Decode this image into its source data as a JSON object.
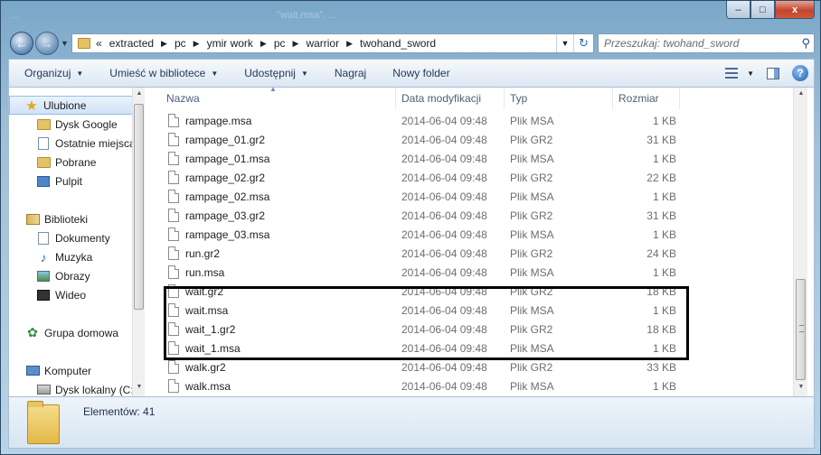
{
  "window": {
    "title_ghost": "...",
    "title_ghost2": "\"wait.msa\", ...",
    "controls": {
      "minimize": "–",
      "maximize": "□",
      "close": "x"
    }
  },
  "address": {
    "overflow": "«",
    "segments": [
      "extracted",
      "pc",
      "ymir work",
      "pc",
      "warrior",
      "twohand_sword"
    ]
  },
  "search": {
    "placeholder": "Przeszukaj: twohand_sword"
  },
  "toolbar": {
    "organize": "Organizuj",
    "library": "Umieść w bibliotece",
    "share": "Udostępnij",
    "burn": "Nagraj",
    "new_folder": "Nowy folder",
    "help": "?"
  },
  "navpane": {
    "favorites": "Ulubione",
    "google_drive": "Dysk Google",
    "recent": "Ostatnie miejsca",
    "downloads": "Pobrane",
    "desktop": "Pulpit",
    "libraries": "Biblioteki",
    "documents": "Dokumenty",
    "music": "Muzyka",
    "pictures": "Obrazy",
    "videos": "Wideo",
    "homegroup": "Grupa domowa",
    "computer": "Komputer",
    "local_disk": "Dysk lokalny (C:)"
  },
  "columns": {
    "name": "Nazwa",
    "date": "Data modyfikacji",
    "type": "Typ",
    "size": "Rozmiar"
  },
  "files": [
    {
      "name": "rampage.msa",
      "date": "2014-06-04 09:48",
      "type": "Plik MSA",
      "size": "1 KB"
    },
    {
      "name": "rampage_01.gr2",
      "date": "2014-06-04 09:48",
      "type": "Plik GR2",
      "size": "31 KB"
    },
    {
      "name": "rampage_01.msa",
      "date": "2014-06-04 09:48",
      "type": "Plik MSA",
      "size": "1 KB"
    },
    {
      "name": "rampage_02.gr2",
      "date": "2014-06-04 09:48",
      "type": "Plik GR2",
      "size": "22 KB"
    },
    {
      "name": "rampage_02.msa",
      "date": "2014-06-04 09:48",
      "type": "Plik MSA",
      "size": "1 KB"
    },
    {
      "name": "rampage_03.gr2",
      "date": "2014-06-04 09:48",
      "type": "Plik GR2",
      "size": "31 KB"
    },
    {
      "name": "rampage_03.msa",
      "date": "2014-06-04 09:48",
      "type": "Plik MSA",
      "size": "1 KB"
    },
    {
      "name": "run.gr2",
      "date": "2014-06-04 09:48",
      "type": "Plik GR2",
      "size": "24 KB"
    },
    {
      "name": "run.msa",
      "date": "2014-06-04 09:48",
      "type": "Plik MSA",
      "size": "1 KB"
    },
    {
      "name": "wait.gr2",
      "date": "2014-06-04 09:48",
      "type": "Plik GR2",
      "size": "18 KB"
    },
    {
      "name": "wait.msa",
      "date": "2014-06-04 09:48",
      "type": "Plik MSA",
      "size": "1 KB"
    },
    {
      "name": "wait_1.gr2",
      "date": "2014-06-04 09:48",
      "type": "Plik GR2",
      "size": "18 KB"
    },
    {
      "name": "wait_1.msa",
      "date": "2014-06-04 09:48",
      "type": "Plik MSA",
      "size": "1 KB"
    },
    {
      "name": "walk.gr2",
      "date": "2014-06-04 09:48",
      "type": "Plik GR2",
      "size": "33 KB"
    },
    {
      "name": "walk.msa",
      "date": "2014-06-04 09:48",
      "type": "Plik MSA",
      "size": "1 KB"
    }
  ],
  "details": {
    "count": "Elementów: 41"
  },
  "colors": {
    "frame": "#9fc0d9",
    "highlight_box": "#000000",
    "accent": "#1e395b"
  }
}
